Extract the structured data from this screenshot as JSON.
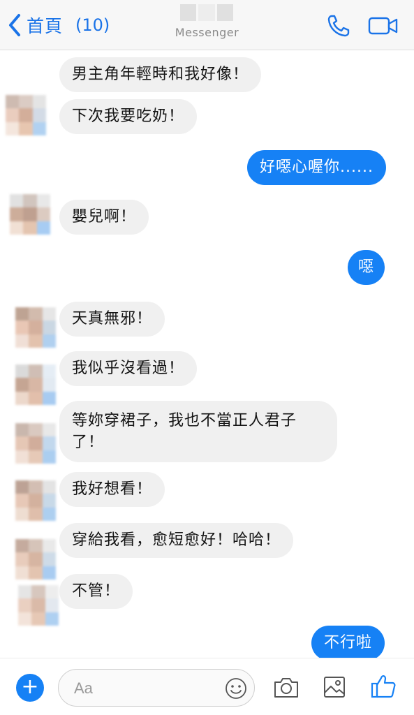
{
  "header": {
    "back_label": "首頁",
    "unread_count": "(10)",
    "subtitle": "Messenger",
    "accent_color": "#1a73e8",
    "icons": [
      "chevron-left-icon",
      "phone-icon",
      "video-camera-icon"
    ]
  },
  "messages": [
    {
      "side": "in",
      "text": "男主角年輕時和我好像！"
    },
    {
      "side": "in",
      "text": "下次我要吃奶！"
    },
    {
      "side": "out",
      "text": "好噁心喔你......"
    },
    {
      "side": "in",
      "text": "嬰兒啊！"
    },
    {
      "side": "out",
      "text": "噁"
    },
    {
      "side": "in",
      "text": "天真無邪！"
    },
    {
      "side": "in",
      "text": "我似乎沒看過！"
    },
    {
      "side": "in",
      "text": "等妳穿裙子，我也不當正人君子了！"
    },
    {
      "side": "in",
      "text": "我好想看！"
    },
    {
      "side": "in",
      "text": "穿給我看，愈短愈好！哈哈！"
    },
    {
      "side": "in",
      "text": "不管！"
    },
    {
      "side": "out",
      "text": "不行啦"
    }
  ],
  "composer": {
    "plus_symbol": "+",
    "placeholder": "Aa",
    "value": "",
    "icons": [
      "plus-icon",
      "emoji-icon",
      "camera-icon",
      "image-icon",
      "thumbs-up-icon"
    ]
  },
  "colors": {
    "outgoing_bubble": "#1681f5",
    "incoming_bubble": "#f0f0f0",
    "header_bg": "#f7f7f7"
  }
}
